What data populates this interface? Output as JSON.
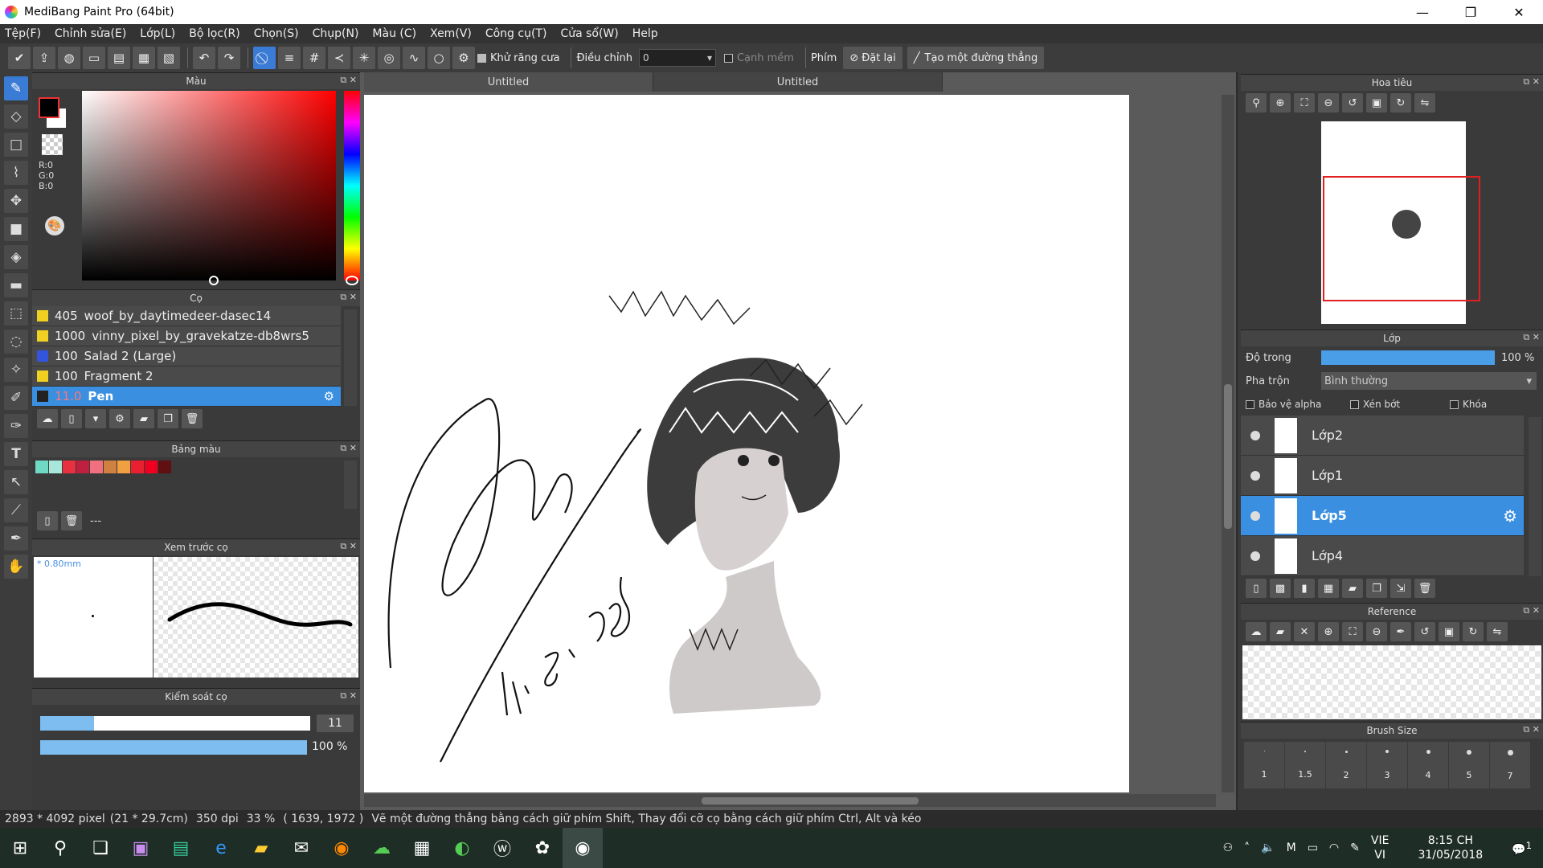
{
  "window": {
    "title": "MediBang Paint Pro (64bit)",
    "minimize": "—",
    "maximize": "❐",
    "close": "✕"
  },
  "menu": [
    "Tệp(F)",
    "Chỉnh sửa(E)",
    "Lớp(L)",
    "Bộ lọc(R)",
    "Chọn(S)",
    "Chụp(N)",
    "Màu (C)",
    "Xem(V)",
    "Công cụ(T)",
    "Cửa sổ(W)",
    "Help"
  ],
  "toolbar": {
    "antialias": "Khử răng cưa",
    "correction": "Điều chỉnh",
    "correction_value": "0",
    "soft_edge": "Cạnh mềm",
    "keys": "Phím",
    "reset": "Đặt lại",
    "straight_line": "Tạo một đường thẳng"
  },
  "color_panel": {
    "title": "Màu",
    "r": "R:0",
    "g": "G:0",
    "b": "B:0",
    "fg": "#000000",
    "bg": "#ffffff"
  },
  "brush_panel": {
    "title": "Cọ",
    "items": [
      {
        "size": "405",
        "name": "woof_by_daytimedeer-dasec14",
        "color": "#f0d020"
      },
      {
        "size": "1000",
        "name": "vinny_pixel_by_gravekatze-db8wrs5",
        "color": "#f0d020"
      },
      {
        "size": "100",
        "name": "Salad 2 (Large)",
        "color": "#3355dd"
      },
      {
        "size": "100",
        "name": "Fragment 2",
        "color": "#f0d020"
      },
      {
        "size": "11.0",
        "name": "Pen",
        "color": "#222222"
      }
    ]
  },
  "palette_panel": {
    "title": "Bảng màu",
    "name": "---",
    "colors": [
      "#6fd9c6",
      "#a8e8da",
      "#e83040",
      "#c02040",
      "#f07080",
      "#d08040",
      "#f0a040",
      "#e82030",
      "#f00020",
      "#601010"
    ]
  },
  "preview_panel": {
    "title": "Xem trước cọ",
    "size": "0.80mm"
  },
  "control_panel": {
    "title": "Kiểm soát cọ",
    "size": "11",
    "opacity": "100 %",
    "size_frac": 0.2,
    "opacity_frac": 1.0
  },
  "tabs": [
    "Untitled",
    "Untitled"
  ],
  "navigator": {
    "title": "Hoa tiêu"
  },
  "layer_panel": {
    "title": "Lớp",
    "opacity_label": "Độ trong",
    "opacity_value": "100 %",
    "blend_label": "Pha trộn",
    "blend_value": "Bình thường",
    "protect_alpha": "Bảo vệ alpha",
    "clipping": "Xén bớt",
    "lock": "Khóa",
    "layers": [
      {
        "name": "Lớp2",
        "selected": false
      },
      {
        "name": "Lớp1",
        "selected": false
      },
      {
        "name": "Lớp5",
        "selected": true
      },
      {
        "name": "Lớp4",
        "selected": false
      }
    ]
  },
  "reference_panel": {
    "title": "Reference"
  },
  "brush_size_panel": {
    "title": "Brush Size",
    "sizes": [
      "1",
      "1.5",
      "2",
      "3",
      "4",
      "5",
      "7"
    ]
  },
  "status": {
    "size": "2893 * 4092 pixel",
    "cm": "(21 * 29.7cm)",
    "dpi": "350 dpi",
    "zoom": "33 %",
    "coords": "( 1639, 1972 )",
    "hint": "Vẽ một đường thẳng bằng cách giữ phím Shift, Thay đổi cỡ cọ bằng cách giữ phím Ctrl, Alt và kéo"
  },
  "taskbar": {
    "lang1": "VIE",
    "lang2": "VI",
    "time": "8:15 CH",
    "date": "31/05/2018",
    "notif": "1"
  }
}
